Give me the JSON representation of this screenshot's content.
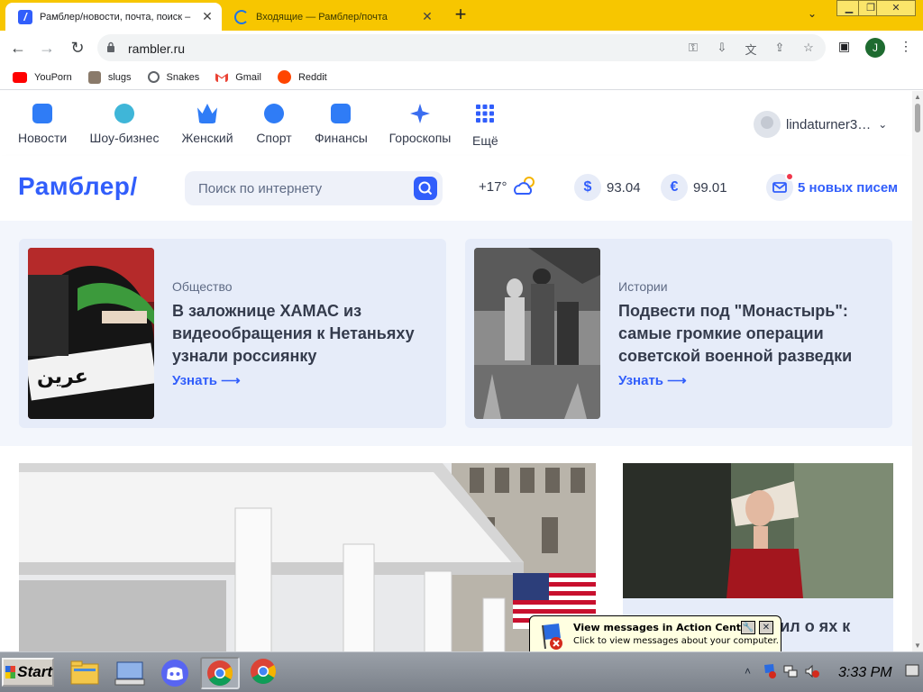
{
  "browser": {
    "tabs": [
      {
        "title": "Рамблер/новости, почта, поиск – ",
        "active": true
      },
      {
        "title": "Входящие — Рамблер/почта",
        "active": false
      }
    ],
    "url": "rambler.ru",
    "profile_letter": "J",
    "accent": "#f7c600"
  },
  "bookmarks": [
    {
      "label": "YouPorn",
      "icon": "youtube-icon"
    },
    {
      "label": "slugs",
      "icon": "image-icon"
    },
    {
      "label": "Snakes",
      "icon": "globe-icon"
    },
    {
      "label": "Gmail",
      "icon": "gmail-icon"
    },
    {
      "label": "Reddit",
      "icon": "reddit-icon"
    }
  ],
  "nav": {
    "items": [
      {
        "label": "Новости",
        "color": "#2f7cf6"
      },
      {
        "label": "Шоу-бизнес",
        "color": "#3fb6d8"
      },
      {
        "label": "Женский",
        "color": "#2f7cf6"
      },
      {
        "label": "Спорт",
        "color": "#2f7cf6"
      },
      {
        "label": "Финансы",
        "color": "#2f7cf6"
      },
      {
        "label": "Гороскопы",
        "color": "#3a6df0"
      },
      {
        "label": "Ещё",
        "color": "#315efb"
      }
    ],
    "user": "lindaturner3…"
  },
  "header": {
    "logo": "Рамблер/",
    "search_placeholder": "Поиск по интернету",
    "weather": "+17°",
    "usd": {
      "symbol": "$",
      "value": "93.04"
    },
    "eur": {
      "symbol": "€",
      "value": "99.01"
    },
    "mail": "5 новых писем",
    "brand_color": "#315efb"
  },
  "promo": [
    {
      "rubric": "Общество",
      "headline": "В заложнице ХАМАС из видеообращения к Нетаньяху узнали россиянку",
      "more": "Узнать ⟶"
    },
    {
      "rubric": "Истории",
      "headline": "Подвести под \"Монастырь\": самые громкие операции советской военной разведки",
      "more": "Узнать ⟶"
    }
  ],
  "sidecard": {
    "text": "мнил о ях к"
  },
  "balloon": {
    "title": "View messages in Action Center",
    "body": "Click to view messages about your computer."
  },
  "taskbar": {
    "start": "Start",
    "clock": "3:33 PM"
  }
}
